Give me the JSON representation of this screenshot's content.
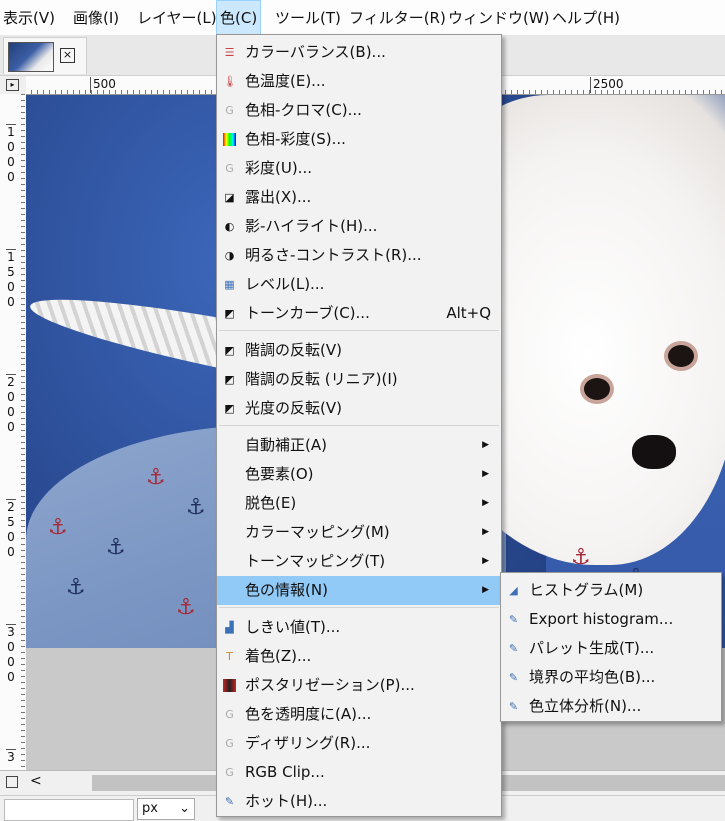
{
  "menubar": {
    "items": [
      {
        "label": "表示(V)"
      },
      {
        "label": "画像(I)"
      },
      {
        "label": "レイヤー(L)"
      },
      {
        "label": "色(C)"
      },
      {
        "label": "ツール(T)"
      },
      {
        "label": "フィルター(R)"
      },
      {
        "label": "ウィンドウ(W)"
      },
      {
        "label": "ヘルプ(H)"
      }
    ],
    "active_index": 3
  },
  "tab": {
    "close_icon": "close-box-icon"
  },
  "rulers": {
    "horizontal": [
      "500",
      "2500"
    ],
    "vertical": [
      "1000",
      "1500",
      "2000",
      "2500",
      "3000",
      "3"
    ]
  },
  "status": {
    "unit": "px"
  },
  "color_menu": {
    "items": [
      {
        "label": "カラーバランス(B)...",
        "icon": "color-balance-icon"
      },
      {
        "label": "色温度(E)...",
        "icon": "thermometer-icon"
      },
      {
        "label": "色相-クロマ(C)...",
        "icon": "gegl-icon"
      },
      {
        "label": "色相-彩度(S)...",
        "icon": "hue-saturation-icon"
      },
      {
        "label": "彩度(U)...",
        "icon": "gegl-icon"
      },
      {
        "label": "露出(X)...",
        "icon": "exposure-icon"
      },
      {
        "label": "影-ハイライト(H)...",
        "icon": "shadows-highlights-icon"
      },
      {
        "label": "明るさ-コントラスト(R)...",
        "icon": "brightness-contrast-icon"
      },
      {
        "label": "レベル(L)...",
        "icon": "levels-icon"
      },
      {
        "label": "トーンカーブ(C)...",
        "icon": "curves-icon",
        "shortcut": "Alt+Q"
      },
      {
        "label": "階調の反転(V)",
        "icon": "invert-icon"
      },
      {
        "label": "階調の反転 (リニア)(I)",
        "icon": "invert-icon"
      },
      {
        "label": "光度の反転(V)",
        "icon": "invert-icon"
      },
      {
        "label": "自動補正(A)"
      },
      {
        "label": "色要素(O)"
      },
      {
        "label": "脱色(E)"
      },
      {
        "label": "カラーマッピング(M)"
      },
      {
        "label": "トーンマッピング(T)"
      },
      {
        "label": "色の情報(N)"
      },
      {
        "label": "しきい値(T)...",
        "icon": "threshold-icon"
      },
      {
        "label": "着色(Z)...",
        "icon": "colorize-icon"
      },
      {
        "label": "ポスタリゼーション(P)...",
        "icon": "posterize-icon"
      },
      {
        "label": "色を透明度に(A)...",
        "icon": "gegl-icon"
      },
      {
        "label": "ディザリング(R)...",
        "icon": "gegl-icon"
      },
      {
        "label": "RGB Clip...",
        "icon": "gegl-icon"
      },
      {
        "label": "ホット(H)...",
        "icon": "plugin-icon"
      }
    ]
  },
  "info_submenu": {
    "items": [
      {
        "label": "ヒストグラム(M)",
        "icon": "histogram-icon"
      },
      {
        "label": "Export histogram...",
        "icon": "plugin-icon"
      },
      {
        "label": "パレット生成(T)...",
        "icon": "plugin-icon"
      },
      {
        "label": "境界の平均色(B)...",
        "icon": "plugin-icon"
      },
      {
        "label": "色立体分析(N)...",
        "icon": "plugin-icon"
      }
    ]
  },
  "colors": {
    "menu_highlight": "#91c9f7",
    "menubar_active": "#cce8ff"
  }
}
